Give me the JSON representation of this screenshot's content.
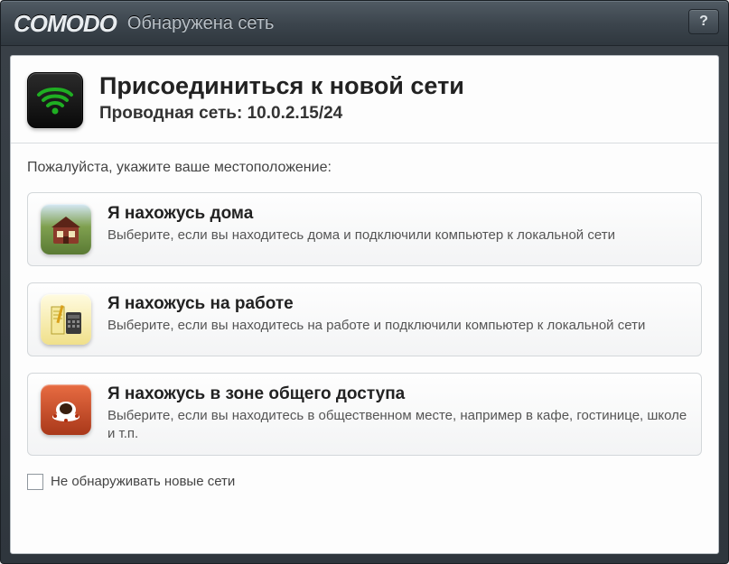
{
  "brand": "COMODO",
  "window_title": "Обнаружена сеть",
  "help_button_label": "?",
  "header": {
    "title": "Присоединиться к новой сети",
    "subtitle": "Проводная сеть: 10.0.2.15/24"
  },
  "prompt": "Пожалуйста, укажите ваше местоположение:",
  "options": [
    {
      "title": "Я нахожусь дома",
      "description": "Выберите, если вы находитесь дома и подключили компьютер к локальной сети"
    },
    {
      "title": "Я нахожусь на работе",
      "description": "Выберите, если вы находитесь на работе и подключили компьютер к локальной сети"
    },
    {
      "title": "Я нахожусь в зоне общего доступа",
      "description": "Выберите, если вы находитесь в общественном месте, например в кафе, гостинице, школе и т.п."
    }
  ],
  "footer": {
    "checkbox_label": "Не обнаруживать новые сети",
    "checked": false
  }
}
